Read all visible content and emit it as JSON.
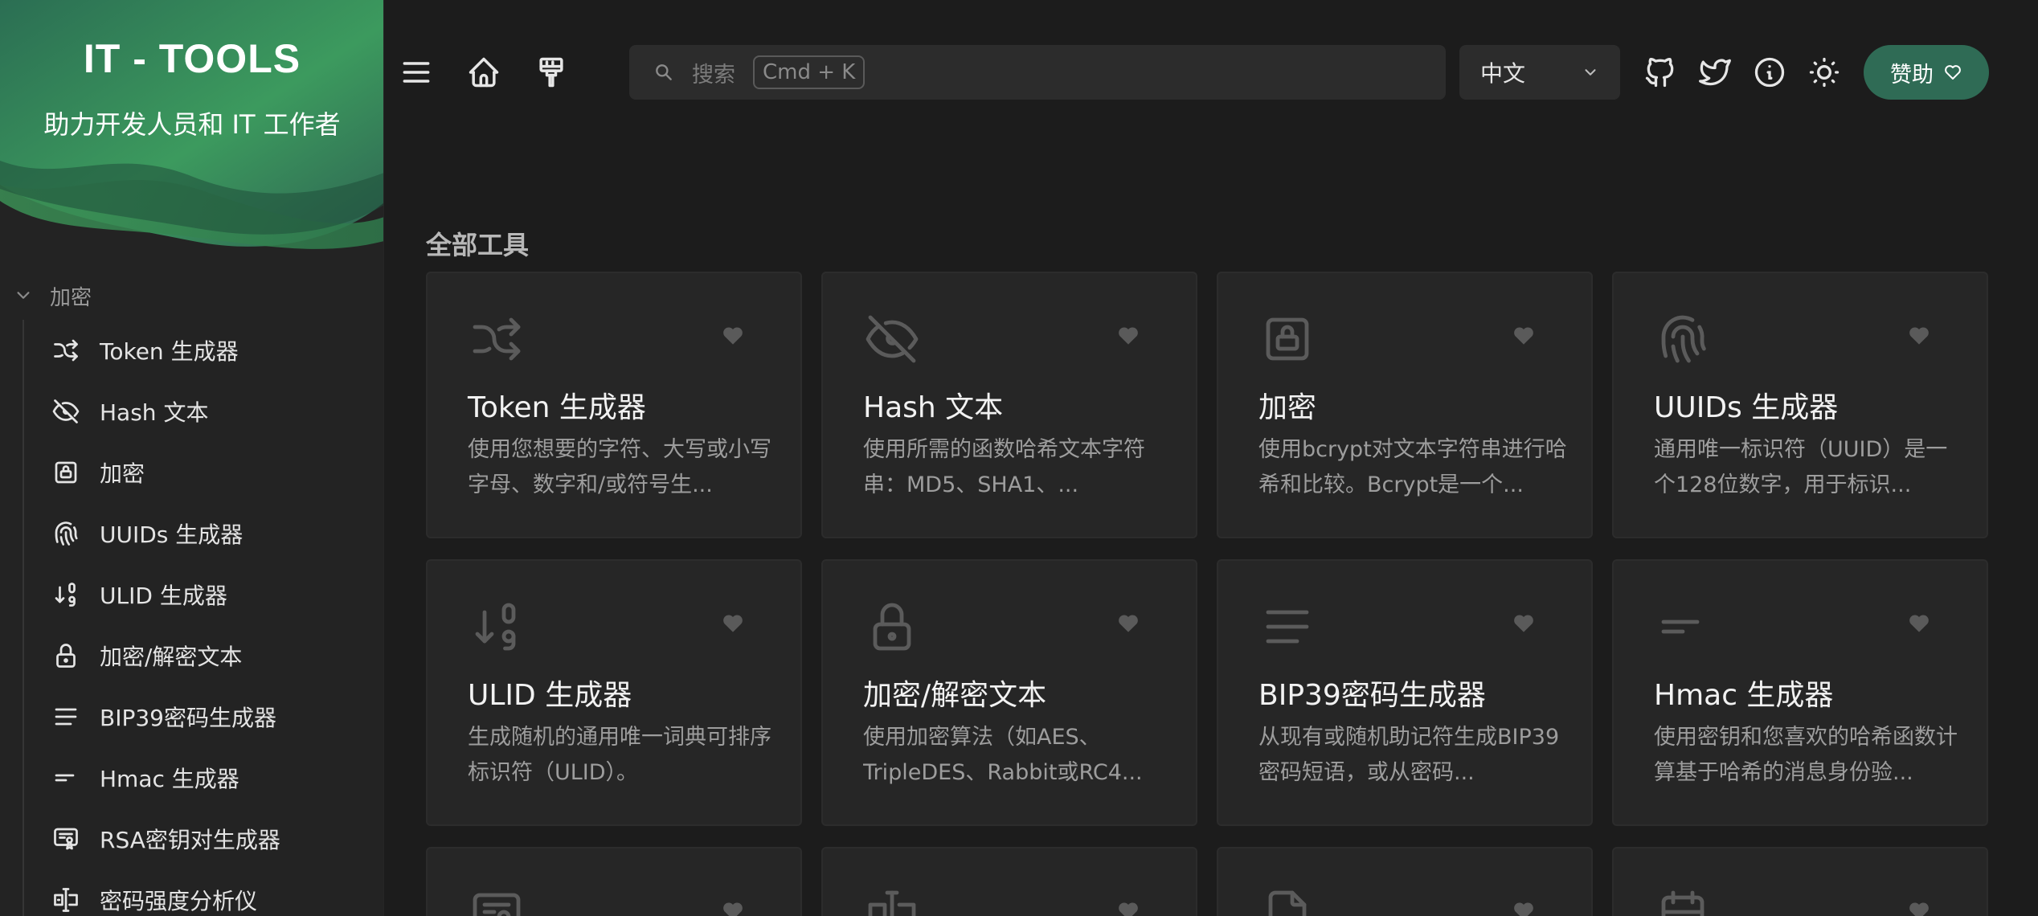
{
  "brand": {
    "title": "IT - TOOLS",
    "subtitle": "助力开发人员和 IT 工作者",
    "gradient_colors": [
      "#2a6b4f",
      "#3f9a5b",
      "#4a9d61",
      "#2f5f50"
    ]
  },
  "sidebar": {
    "section_label": "加密",
    "items": [
      {
        "label": "Token 生成器",
        "icon": "shuffle-icon"
      },
      {
        "label": "Hash 文本",
        "icon": "eye-off-icon"
      },
      {
        "label": "加密",
        "icon": "lock-square-icon"
      },
      {
        "label": "UUIDs 生成器",
        "icon": "fingerprint-icon"
      },
      {
        "label": "ULID 生成器",
        "icon": "sort-numeric-icon"
      },
      {
        "label": "加密/解密文本",
        "icon": "lock-icon"
      },
      {
        "label": "BIP39密码生成器",
        "icon": "lines-icon"
      },
      {
        "label": "Hmac 生成器",
        "icon": "short-lines-icon"
      },
      {
        "label": "RSA密钥对生成器",
        "icon": "certificate-icon"
      },
      {
        "label": "密码强度分析仪",
        "icon": "password-icon"
      }
    ]
  },
  "topbar": {
    "search_placeholder": "搜索",
    "search_shortcut": "Cmd + K",
    "language": "中文",
    "donate_label": "赞助",
    "accent": "#2f6b55"
  },
  "main": {
    "section_title": "全部工具",
    "cards": [
      {
        "title": "Token 生成器",
        "desc": "使用您想要的字符、大写或小写字母、数字和/或符号生...",
        "icon": "shuffle-icon"
      },
      {
        "title": "Hash 文本",
        "desc": "使用所需的函数哈希文本字符串：MD5、SHA1、...",
        "icon": "eye-off-icon"
      },
      {
        "title": "加密",
        "desc": "使用bcrypt对文本字符串进行哈希和比较。Bcrypt是一个...",
        "icon": "lock-square-icon"
      },
      {
        "title": "UUIDs 生成器",
        "desc": "通用唯一标识符（UUID）是一个128位数字，用于标识...",
        "icon": "fingerprint-icon"
      },
      {
        "title": "ULID 生成器",
        "desc": "生成随机的通用唯一词典可排序标识符（ULID）。",
        "icon": "sort-numeric-icon"
      },
      {
        "title": "加密/解密文本",
        "desc": "使用加密算法（如AES、TripleDES、Rabbit或RC4...",
        "icon": "lock-icon"
      },
      {
        "title": "BIP39密码生成器",
        "desc": "从现有或随机助记符生成BIP39密码短语，或从密码...",
        "icon": "lines-icon"
      },
      {
        "title": "Hmac 生成器",
        "desc": "使用密钥和您喜欢的哈希函数计算基于哈希的消息身份验...",
        "icon": "short-lines-icon"
      }
    ]
  }
}
